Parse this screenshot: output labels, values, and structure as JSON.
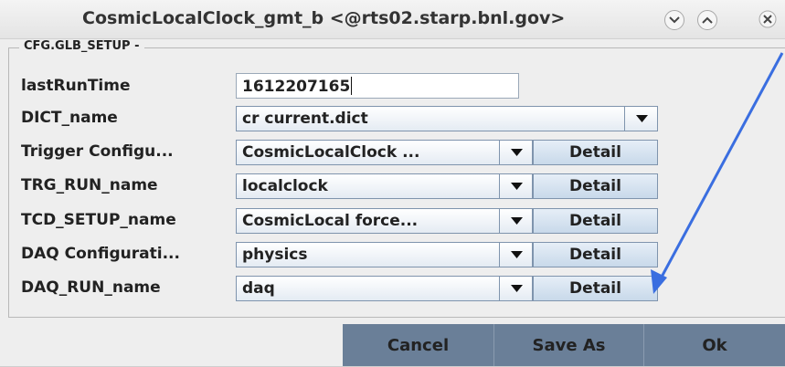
{
  "window": {
    "title": "CosmicLocalClock_gmt_b <@rts02.starp.bnl.gov>",
    "title_buttons": [
      "chevron-down",
      "chevron-up",
      "close"
    ]
  },
  "group": {
    "legend": "CFG.GLB_SETUP -"
  },
  "rows": [
    {
      "label": "lastRunTime",
      "value": "1612207165"
    },
    {
      "label": "DICT_name",
      "value": "cr current.dict"
    },
    {
      "label": "Trigger Configu...",
      "value": "CosmicLocalClock ...",
      "button": "Detail"
    },
    {
      "label": "TRG_RUN_name",
      "value": "localclock",
      "button": "Detail"
    },
    {
      "label": "TCD_SETUP_name",
      "value": "CosmicLocal force...",
      "button": "Detail"
    },
    {
      "label": "DAQ Configurati...",
      "value": "physics",
      "button": "Detail"
    },
    {
      "label": "DAQ_RUN_name",
      "value": "daq",
      "button": "Detail"
    }
  ],
  "footer": {
    "cancel": "Cancel",
    "save_as": "Save As",
    "ok": "Ok"
  },
  "annotation": {
    "arrow_color": "#3a6ee0"
  },
  "colors": {
    "footer_button": "#6a7f98",
    "detail_button": "#c8d9ea"
  }
}
